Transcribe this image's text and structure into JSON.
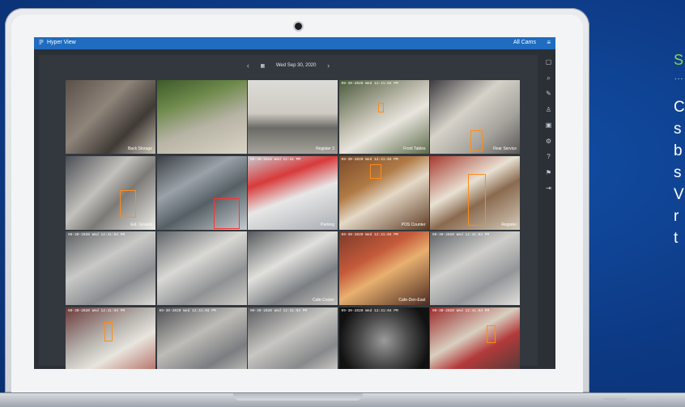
{
  "app": {
    "logo_glyph": "ℙ",
    "title": "Hyper View",
    "view_label": "All Cams",
    "menu_glyph": "≡"
  },
  "toolbar": {
    "prev_glyph": "‹",
    "calendar_glyph": "▦",
    "date": "Wed Sep 30, 2020",
    "next_glyph": "›"
  },
  "sidebar_icons": [
    {
      "name": "monitor-icon",
      "glyph": "▢"
    },
    {
      "name": "search-icon",
      "glyph": "⌕"
    },
    {
      "name": "pen-icon",
      "glyph": "✎"
    },
    {
      "name": "user-icon",
      "glyph": "♙"
    },
    {
      "name": "camera-icon",
      "glyph": "▣"
    },
    {
      "name": "settings-icon",
      "glyph": "⚙"
    },
    {
      "name": "help-icon",
      "glyph": "?"
    },
    {
      "name": "flag-icon",
      "glyph": "⚑"
    },
    {
      "name": "logout-icon",
      "glyph": "⇥"
    }
  ],
  "cameras": [
    {
      "label": "Back Storage",
      "ts": ""
    },
    {
      "label": "",
      "ts": ""
    },
    {
      "label": "Register 3",
      "ts": ""
    },
    {
      "label": "Front Tables",
      "ts": "09-30-2020 Wed 12:41:04 PM"
    },
    {
      "label": "Rear Service",
      "ts": ""
    },
    {
      "label": "Ext. Ground",
      "ts": ""
    },
    {
      "label": "",
      "ts": ""
    },
    {
      "label": "Parking",
      "ts": "09-30-2020 Wed 12:41 PM"
    },
    {
      "label": "POS Counter",
      "ts": "09-30-2020 Wed 12:41:04 PM"
    },
    {
      "label": "Register",
      "ts": ""
    },
    {
      "label": "",
      "ts": "09-30-2020 Wed 12:41:04 PM"
    },
    {
      "label": "",
      "ts": ""
    },
    {
      "label": "Cafe-Cooler",
      "ts": ""
    },
    {
      "label": "Cafe-Den-East",
      "ts": "09-30-2020 Wed 12:41:04 PM"
    },
    {
      "label": "",
      "ts": "09-30-2020 Wed 12:41:04 PM"
    },
    {
      "label": "",
      "ts": "09-30-2020 Wed 12:41:04 PM"
    },
    {
      "label": "",
      "ts": "09-30-2020 Wed 12:41:04 PM"
    },
    {
      "label": "",
      "ts": "09-30-2020 Wed 12:41:04 PM"
    },
    {
      "label": "",
      "ts": "09-30-2020 Wed 12:41:04 PM"
    },
    {
      "label": "",
      "ts": "09-30-2020 Wed 12:41:04 PM"
    }
  ],
  "side_text": {
    "heading": "S",
    "dots": "...",
    "lines": [
      "C",
      "s",
      "b",
      "s",
      "V",
      "r",
      "t"
    ]
  },
  "colors": {
    "background": "#0d3a85",
    "titlebar": "#1f6cc0",
    "heading_accent": "#8fd14f",
    "detection_box": "#ff8c1a"
  }
}
